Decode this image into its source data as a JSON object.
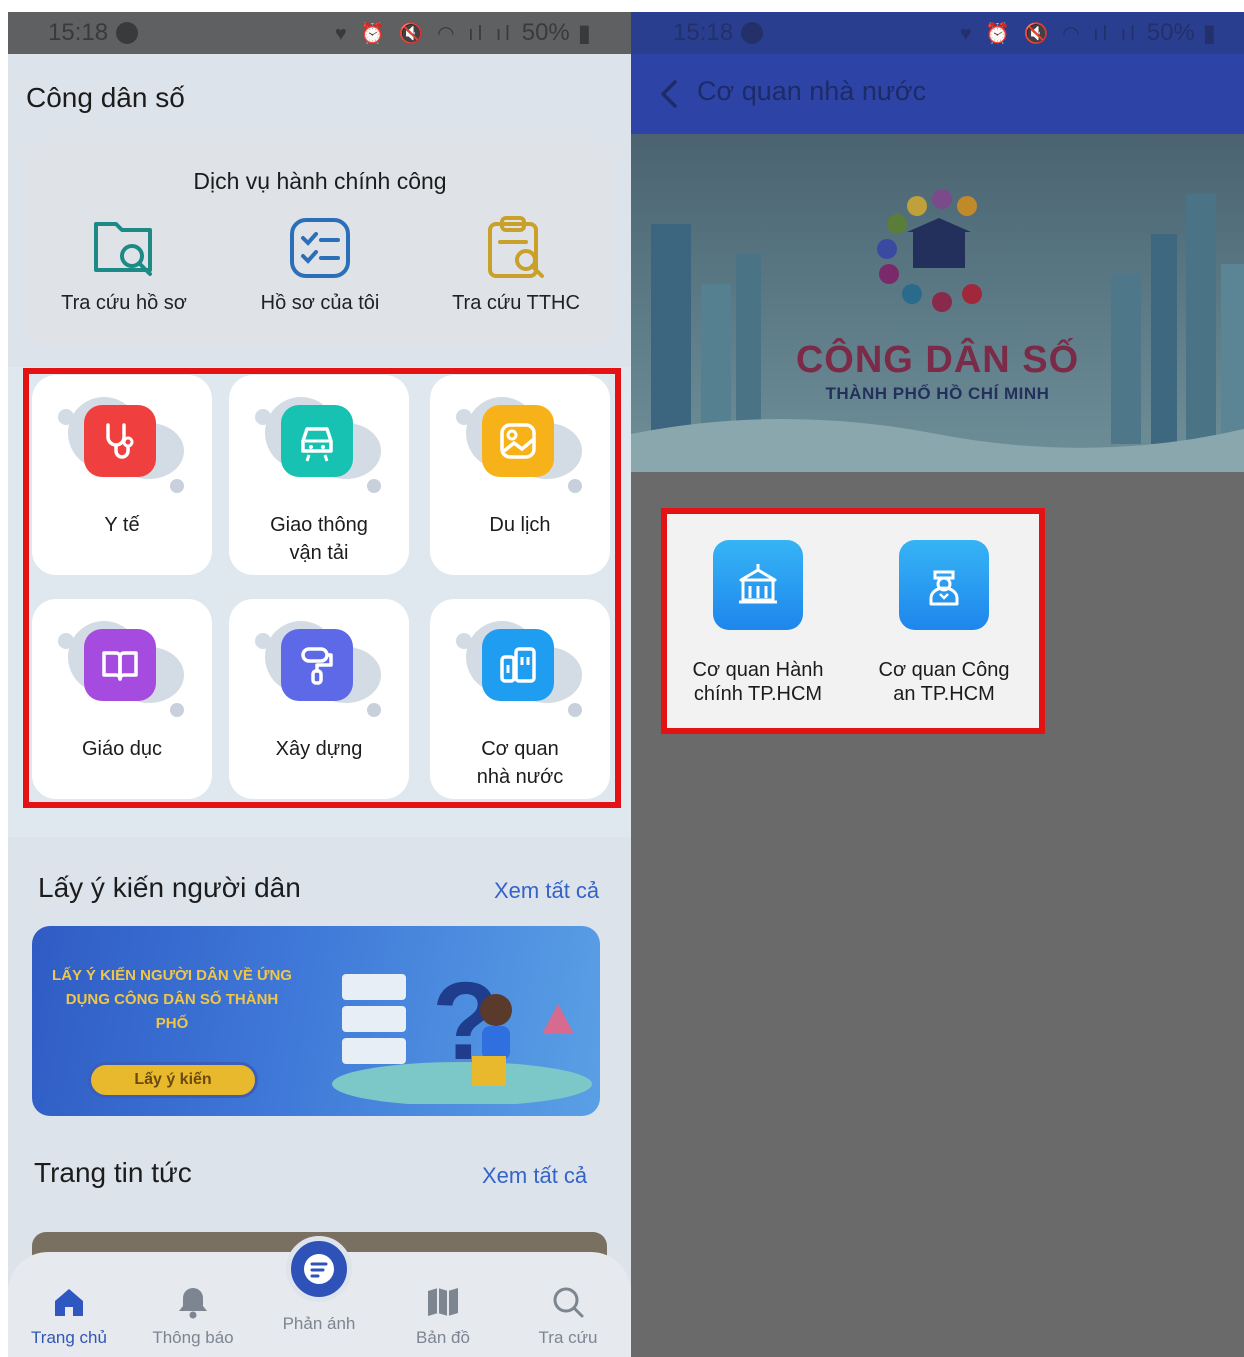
{
  "left": {
    "status": {
      "time": "15:18",
      "battery": "50%"
    },
    "title": "Công dân số",
    "admin": {
      "title": "Dịch vụ hành chính công",
      "items": [
        {
          "label": "Tra cứu hồ sơ",
          "icon": "folder-search-icon"
        },
        {
          "label": "Hồ sơ của tôi",
          "icon": "checklist-icon"
        },
        {
          "label": "Tra cứu TTHC",
          "icon": "clipboard-search-icon"
        }
      ]
    },
    "categories": [
      {
        "label": "Y tế",
        "icon": "stethoscope-icon",
        "color": "#ef3f3f"
      },
      {
        "label": "Giao thông vận tải",
        "icon": "car-icon",
        "color": "#18c2b3"
      },
      {
        "label": "Du lịch",
        "icon": "image-icon",
        "color": "#f7b21a"
      },
      {
        "label": "Giáo dục",
        "icon": "book-icon",
        "color": "#a64be0"
      },
      {
        "label": "Xây dựng",
        "icon": "paint-roller-icon",
        "color": "#5d69e6"
      },
      {
        "label": "Cơ quan nhà nước",
        "icon": "buildings-icon",
        "color": "#1f9df0"
      }
    ],
    "survey": {
      "heading": "Lấy ý kiến người dân",
      "see_all": "Xem tất cả",
      "banner_text": "LẤY Ý KIẾN NGƯỜI DÂN VỀ ỨNG DỤNG CÔNG DÂN SỐ THÀNH PHỐ",
      "banner_button": "Lấy ý kiến"
    },
    "news": {
      "heading": "Trang tin tức",
      "see_all": "Xem tất cả"
    },
    "nav": [
      {
        "label": "Trang chủ",
        "icon": "home-icon"
      },
      {
        "label": "Thông báo",
        "icon": "bell-icon"
      },
      {
        "label": "Phản ánh",
        "icon": "feedback-icon"
      },
      {
        "label": "Bản đồ",
        "icon": "map-icon"
      },
      {
        "label": "Tra cứu",
        "icon": "search-icon"
      }
    ]
  },
  "right": {
    "status": {
      "time": "15:18",
      "battery": "50%"
    },
    "title": "Cơ quan nhà nước",
    "hero": {
      "title": "CÔNG DÂN SỐ",
      "subtitle": "THÀNH PHỐ HỒ CHÍ MINH"
    },
    "agencies": [
      {
        "label": "Cơ quan Hành chính TP.HCM",
        "icon": "government-building-icon"
      },
      {
        "label": "Cơ quan Công an TP.HCM",
        "icon": "police-icon"
      }
    ]
  }
}
